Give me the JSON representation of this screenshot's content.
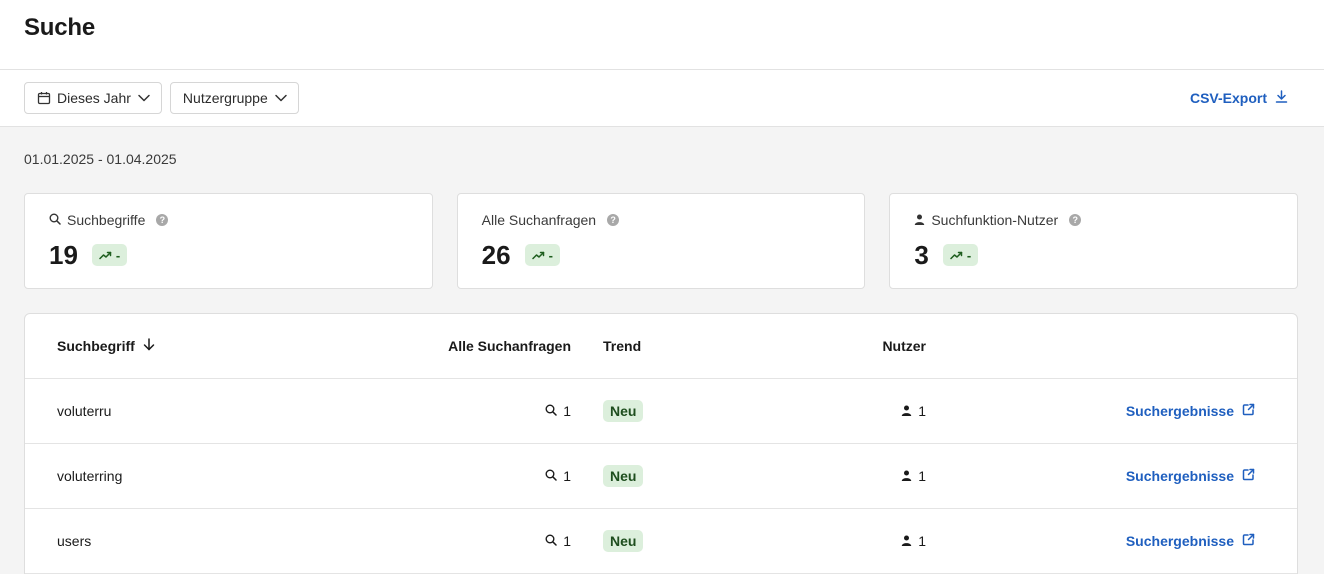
{
  "page": {
    "title": "Suche"
  },
  "toolbar": {
    "date_filter": {
      "label": "Dieses Jahr",
      "icon": "calendar-icon"
    },
    "group_filter": {
      "label": "Nutzergruppe"
    },
    "export": {
      "label": "CSV-Export",
      "icon": "download-icon"
    }
  },
  "date_range": "01.01.2025 - 01.04.2025",
  "cards": [
    {
      "label": "Suchbegriffe",
      "icon": "search-icon",
      "value": "19",
      "trend": "-"
    },
    {
      "label": "Alle Suchanfragen",
      "icon": "",
      "value": "26",
      "trend": "-"
    },
    {
      "label": "Suchfunktion-Nutzer",
      "icon": "user-icon",
      "value": "3",
      "trend": "-"
    }
  ],
  "table": {
    "columns": {
      "term": "Suchbegriff",
      "count": "Alle Suchanfragen",
      "trend": "Trend",
      "users": "Nutzer"
    },
    "rows": [
      {
        "term": "voluterru",
        "count": "1",
        "trend": "Neu",
        "users": "1",
        "link": "Suchergebnisse"
      },
      {
        "term": "voluterring",
        "count": "1",
        "trend": "Neu",
        "users": "1",
        "link": "Suchergebnisse"
      },
      {
        "term": "users",
        "count": "1",
        "trend": "Neu",
        "users": "1",
        "link": "Suchergebnisse"
      }
    ]
  },
  "colors": {
    "accent": "#1f5fbf",
    "badge_bg": "#dcefdc",
    "badge_text": "#1e5e1e"
  }
}
